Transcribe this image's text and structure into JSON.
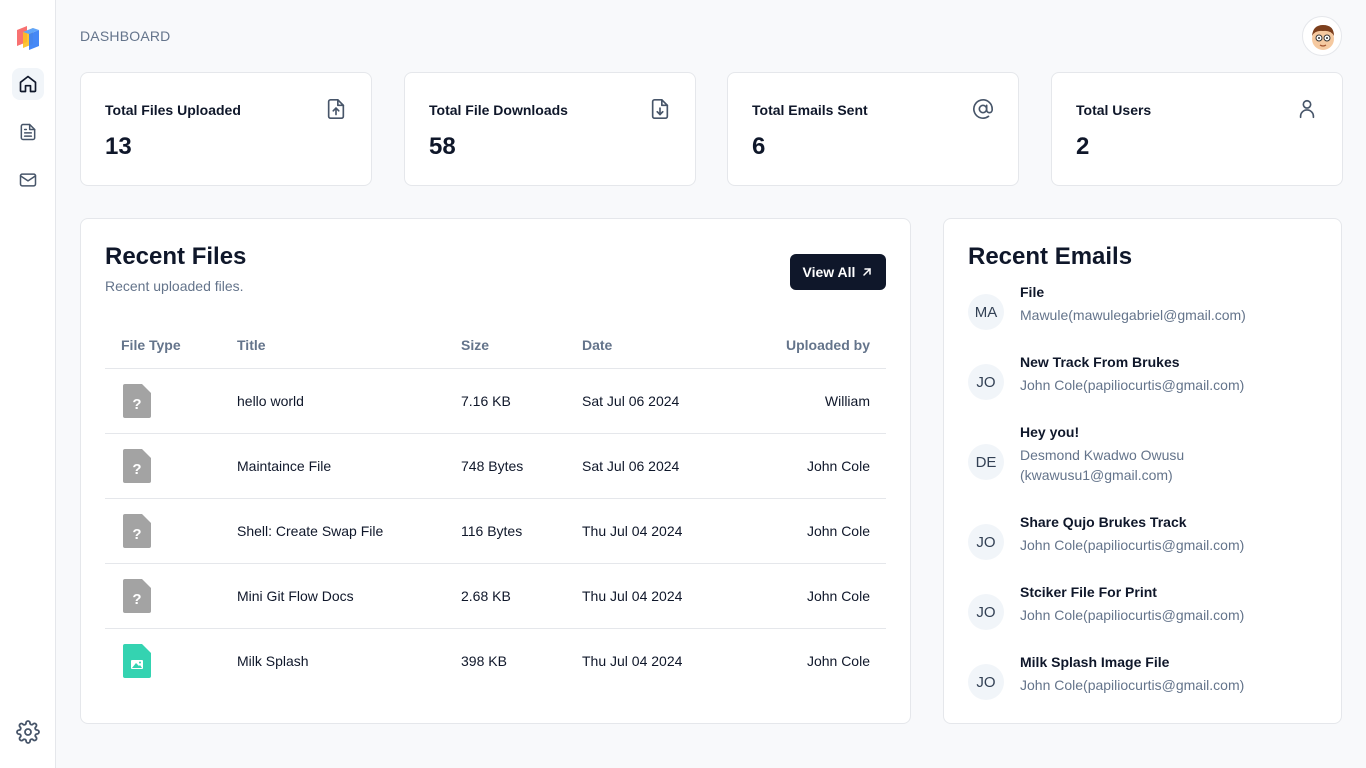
{
  "header": {
    "title": "DASHBOARD"
  },
  "sidebar": {
    "items": [
      {
        "name": "home",
        "icon": "home-icon",
        "active": true
      },
      {
        "name": "files",
        "icon": "document-icon",
        "active": false
      },
      {
        "name": "emails",
        "icon": "mail-icon",
        "active": false
      }
    ],
    "footer_icon": "gear-icon"
  },
  "stats": [
    {
      "label": "Total Files Uploaded",
      "value": "13",
      "icon": "file-upload-icon"
    },
    {
      "label": "Total File Downloads",
      "value": "58",
      "icon": "file-download-icon"
    },
    {
      "label": "Total Emails Sent",
      "value": "6",
      "icon": "at-sign-icon"
    },
    {
      "label": "Total Users",
      "value": "2",
      "icon": "user-icon"
    }
  ],
  "recent_files": {
    "title": "Recent Files",
    "subtitle": "Recent uploaded files.",
    "view_all_label": "View All",
    "columns": [
      "File Type",
      "Title",
      "Size",
      "Date",
      "Uploaded by"
    ],
    "rows": [
      {
        "type": "unknown",
        "title": "hello world",
        "size": "7.16 KB",
        "date": "Sat Jul 06 2024",
        "uploaded_by": "William"
      },
      {
        "type": "unknown",
        "title": "Maintaince File",
        "size": "748 Bytes",
        "date": "Sat Jul 06 2024",
        "uploaded_by": "John Cole"
      },
      {
        "type": "unknown",
        "title": "Shell: Create Swap File",
        "size": "116 Bytes",
        "date": "Thu Jul 04 2024",
        "uploaded_by": "John Cole"
      },
      {
        "type": "unknown",
        "title": "Mini Git Flow Docs",
        "size": "2.68 KB",
        "date": "Thu Jul 04 2024",
        "uploaded_by": "John Cole"
      },
      {
        "type": "image",
        "title": "Milk Splash",
        "size": "398 KB",
        "date": "Thu Jul 04 2024",
        "uploaded_by": "John Cole"
      }
    ]
  },
  "recent_emails": {
    "title": "Recent Emails",
    "items": [
      {
        "initials": "MA",
        "subject": "File",
        "from": "Mawule(mawulegabriel@gmail.com)"
      },
      {
        "initials": "JO",
        "subject": "New Track From Brukes",
        "from": "John Cole(papiliocurtis@gmail.com)"
      },
      {
        "initials": "DE",
        "subject": "Hey you!",
        "from": "Desmond Kwadwo Owusu (kwawusu1@gmail.com)"
      },
      {
        "initials": "JO",
        "subject": "Share Qujo Brukes Track",
        "from": "John Cole(papiliocurtis@gmail.com)"
      },
      {
        "initials": "JO",
        "subject": "Stciker File For Print",
        "from": "John Cole(papiliocurtis@gmail.com)"
      },
      {
        "initials": "JO",
        "subject": "Milk Splash Image File",
        "from": "John Cole(papiliocurtis@gmail.com)"
      }
    ]
  },
  "colors": {
    "primary_button": "#0f172a",
    "unknown_file": "#a3a3a3",
    "image_file": "#34d3b1",
    "muted_text": "#64748b"
  }
}
